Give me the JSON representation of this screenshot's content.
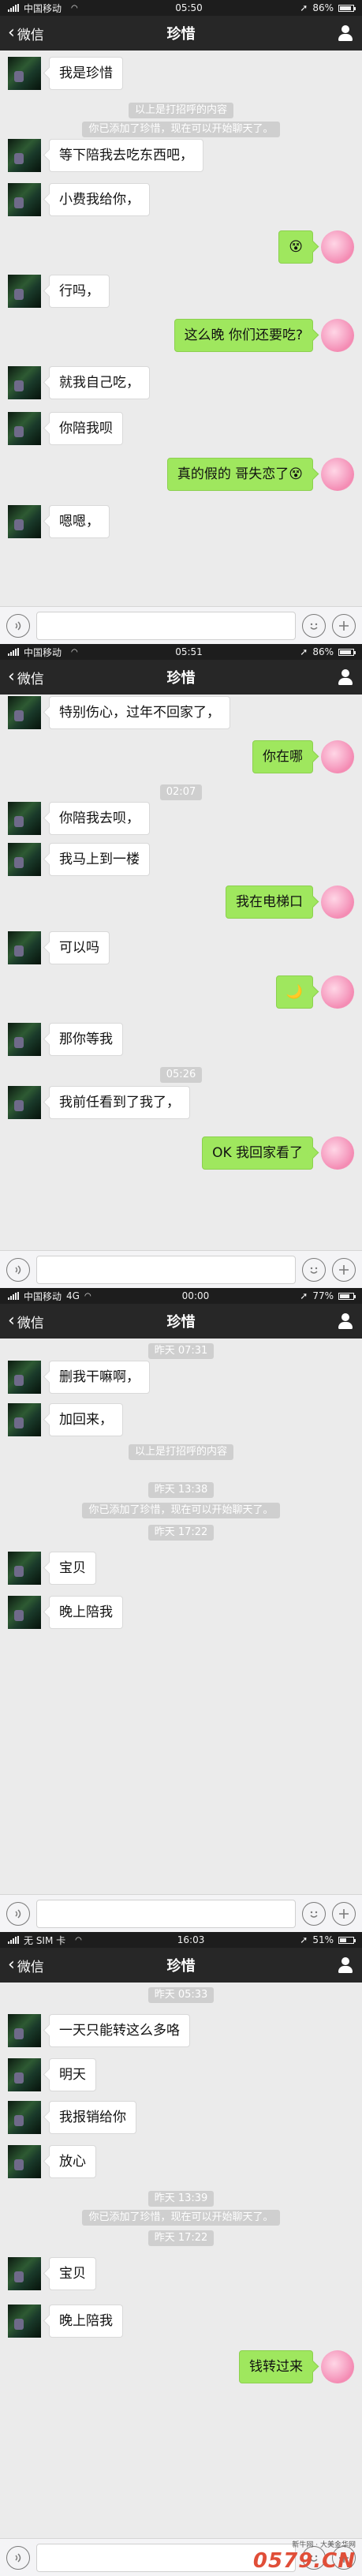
{
  "panels": [
    {
      "status": {
        "carrier": "中国移动",
        "time": "05:50",
        "battery": "86%",
        "battery_level": 0.86
      },
      "nav": {
        "back_label": "微信",
        "title": "珍惜"
      },
      "messages": [
        {
          "kind": "in",
          "text": "我是珍惜"
        },
        {
          "kind": "sys",
          "text": "以上是打招呼的内容"
        },
        {
          "kind": "sys",
          "text": "你已添加了珍惜，现在可以开始聊天了。"
        },
        {
          "kind": "in",
          "text": "等下陪我去吃东西吧，"
        },
        {
          "kind": "in",
          "text": "小费我给你，"
        },
        {
          "kind": "out",
          "text": "😵"
        },
        {
          "kind": "in",
          "text": "行吗，"
        },
        {
          "kind": "out",
          "text": "这么晚 你们还要吃?"
        },
        {
          "kind": "in",
          "text": "就我自己吃，"
        },
        {
          "kind": "in",
          "text": "你陪我呗"
        },
        {
          "kind": "out",
          "text": "真的假的 哥失恋了😵"
        },
        {
          "kind": "in",
          "text": "嗯嗯，"
        }
      ]
    },
    {
      "status": {
        "carrier": "中国移动",
        "time": "05:51",
        "battery": "86%",
        "battery_level": 0.86
      },
      "nav": {
        "back_label": "微信",
        "title": "珍惜"
      },
      "messages": [
        {
          "kind": "in",
          "text": "特别伤心，过年不回家了，"
        },
        {
          "kind": "out",
          "text": "你在哪"
        },
        {
          "kind": "sys",
          "text": "02:07"
        },
        {
          "kind": "in",
          "text": "你陪我去呗，"
        },
        {
          "kind": "in",
          "text": "我马上到一楼"
        },
        {
          "kind": "out",
          "text": "我在电梯口"
        },
        {
          "kind": "in",
          "text": "可以吗"
        },
        {
          "kind": "out",
          "text": "🌙"
        },
        {
          "kind": "in",
          "text": "那你等我"
        },
        {
          "kind": "sys",
          "text": "05:26"
        },
        {
          "kind": "in",
          "text": "我前任看到了我了，"
        },
        {
          "kind": "out",
          "text": "OK 我回家看了"
        }
      ]
    },
    {
      "status": {
        "carrier": "中国移动",
        "network": "4G",
        "time": "00:00",
        "battery": "77%",
        "battery_level": 0.77
      },
      "nav": {
        "back_label": "微信",
        "title": "珍惜"
      },
      "messages": [
        {
          "kind": "sys",
          "text": "昨天 07:31"
        },
        {
          "kind": "in",
          "text": "删我干嘛啊，"
        },
        {
          "kind": "in",
          "text": "加回来，"
        },
        {
          "kind": "sys",
          "text": "以上是打招呼的内容"
        },
        {
          "kind": "sys",
          "text": "昨天 13:38"
        },
        {
          "kind": "sys",
          "text": "你已添加了珍惜，现在可以开始聊天了。"
        },
        {
          "kind": "sys",
          "text": "昨天 17:22"
        },
        {
          "kind": "in",
          "text": "宝贝"
        },
        {
          "kind": "in",
          "text": "晚上陪我"
        }
      ]
    },
    {
      "status": {
        "carrier": "无 SIM 卡",
        "time": "16:03",
        "battery": "51%",
        "battery_level": 0.51
      },
      "nav": {
        "back_label": "微信",
        "title": "珍惜"
      },
      "messages": [
        {
          "kind": "sys",
          "text": "昨天 05:33"
        },
        {
          "kind": "in",
          "text": "一天只能转这么多咯"
        },
        {
          "kind": "in",
          "text": "明天"
        },
        {
          "kind": "in",
          "text": "我报销给你"
        },
        {
          "kind": "in",
          "text": "放心"
        },
        {
          "kind": "sys",
          "text": "昨天 13:39"
        },
        {
          "kind": "sys",
          "text": "你已添加了珍惜，现在可以开始聊天了。"
        },
        {
          "kind": "sys",
          "text": "昨天 17:22"
        },
        {
          "kind": "in",
          "text": "宝贝"
        },
        {
          "kind": "in",
          "text": "晚上陪我"
        },
        {
          "kind": "out",
          "text": "钱转过来"
        }
      ]
    }
  ],
  "watermark": {
    "line": "新牛网 · 大美金华网",
    "logo": "0579.CN"
  },
  "colors": {
    "bubble_out": "#9fe75e",
    "nav_bg": "#272727",
    "status_bg": "#1d1d1d",
    "chat_bg": "#ebebeb"
  }
}
